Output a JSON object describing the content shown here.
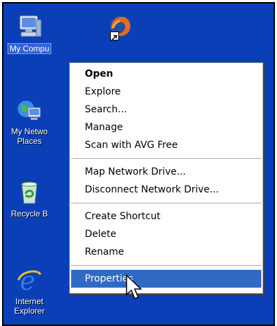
{
  "desktop": {
    "background_color": "#0a3fb8",
    "icons": [
      {
        "label": "My Compu",
        "icon": "my-computer-icon",
        "selected": true
      },
      {
        "label": "",
        "icon": "firefox-icon"
      },
      {
        "label": "My Netwo\nPlaces",
        "icon": "my-network-places-icon"
      },
      {
        "label": "Recycle B",
        "icon": "recycle-bin-icon"
      },
      {
        "label": "Internet\nExplorer",
        "icon": "internet-explorer-icon"
      }
    ]
  },
  "context_menu": {
    "items": [
      {
        "label": "Open",
        "bold": true
      },
      {
        "label": "Explore"
      },
      {
        "label": "Search..."
      },
      {
        "label": "Manage"
      },
      {
        "label": "Scan with AVG Free"
      },
      {
        "label": "Map Network Drive..."
      },
      {
        "label": "Disconnect Network Drive..."
      },
      {
        "label": "Create Shortcut"
      },
      {
        "label": "Delete"
      },
      {
        "label": "Rename"
      },
      {
        "label": "Properties",
        "highlighted": true
      }
    ],
    "highlight_color": "#316ac5"
  }
}
